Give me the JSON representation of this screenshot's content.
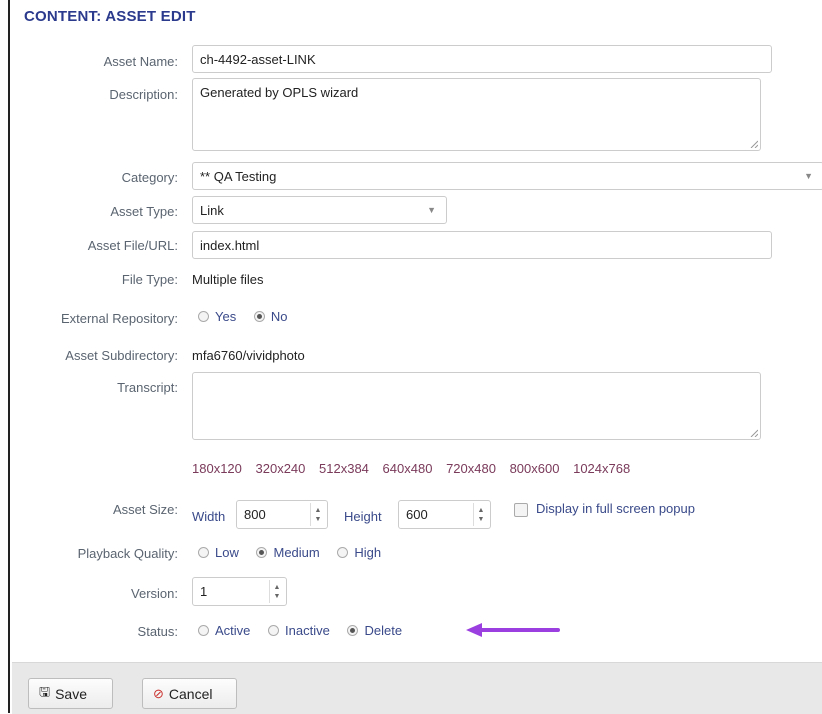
{
  "title": "CONTENT: ASSET EDIT",
  "fields": {
    "asset_name": {
      "label": "Asset Name:",
      "value": "ch-4492-asset-LINK"
    },
    "description": {
      "label": "Description:",
      "value": "Generated by OPLS wizard"
    },
    "category": {
      "label": "Category:",
      "value": "** QA Testing"
    },
    "asset_type": {
      "label": "Asset Type:",
      "value": "Link"
    },
    "asset_file": {
      "label": "Asset File/URL:",
      "value": "index.html"
    },
    "file_type": {
      "label": "File Type:",
      "value": "Multiple files"
    },
    "external_repo": {
      "label": "External Repository:",
      "options": [
        "Yes",
        "No"
      ],
      "selected": "No"
    },
    "subdirectory": {
      "label": "Asset Subdirectory:",
      "value": "mfa6760/vividphoto"
    },
    "transcript": {
      "label": "Transcript:",
      "value": ""
    },
    "size_presets": [
      "180x120",
      "320x240",
      "512x384",
      "640x480",
      "720x480",
      "800x600",
      "1024x768"
    ],
    "asset_size": {
      "label": "Asset Size:",
      "width_label": "Width",
      "width": "800",
      "height_label": "Height",
      "height": "600",
      "fullscreen_label": "Display in full screen popup",
      "fullscreen_checked": false
    },
    "playback_quality": {
      "label": "Playback Quality:",
      "options": [
        "Low",
        "Medium",
        "High"
      ],
      "selected": "Medium"
    },
    "version": {
      "label": "Version:",
      "value": "1"
    },
    "status": {
      "label": "Status:",
      "options": [
        "Active",
        "Inactive",
        "Delete"
      ],
      "selected": "Delete"
    }
  },
  "buttons": {
    "save": "Save",
    "cancel": "Cancel"
  },
  "colors": {
    "title": "#2b3a8c",
    "annotation_arrow": "#9b3fe0"
  }
}
